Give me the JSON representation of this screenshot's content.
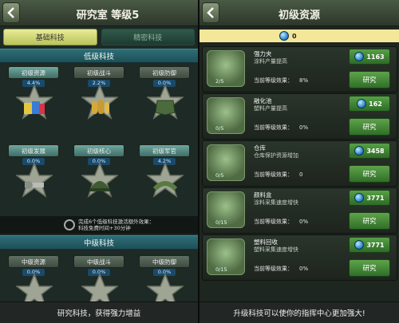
{
  "left": {
    "title": "研究室 等级5",
    "tabs": [
      "基础科技",
      "精密科技"
    ],
    "basic_section": "低级科技",
    "mid_section": "中级科技",
    "techs": [
      {
        "label": "初级资源",
        "pct": "4.4%",
        "lit": true
      },
      {
        "label": "初级战斗",
        "pct": "2.2%",
        "lit": false
      },
      {
        "label": "初级防御",
        "pct": "0.0%",
        "lit": false
      },
      {
        "label": "初级发展",
        "pct": "0.0%",
        "lit": true
      },
      {
        "label": "初级核心",
        "pct": "0.0%",
        "lit": true
      },
      {
        "label": "初级军官",
        "pct": "4.2%",
        "lit": true
      }
    ],
    "mid_techs": [
      {
        "label": "中级资源",
        "pct": "0.0%"
      },
      {
        "label": "中级战斗",
        "pct": "0.0%"
      },
      {
        "label": "中级防御",
        "pct": "0.0%"
      }
    ],
    "notice": [
      "完成6个低级科技激活额外效果：",
      "科技免费时间+30分钟"
    ],
    "footer": "研究科技，获得强力增益"
  },
  "right": {
    "title": "初级资源",
    "resource_value": "0",
    "rows": [
      {
        "name": "强力夹",
        "desc": "涂料产量提高",
        "effect_label": "当前等级效果：",
        "effect": "8%",
        "level": "2/5",
        "cost": "1163",
        "button": "研究"
      },
      {
        "name": "融化池",
        "desc": "塑料产量提高",
        "effect_label": "当前等级效果：",
        "effect": "0%",
        "level": "0/5",
        "cost": "162",
        "button": "研究"
      },
      {
        "name": "仓库",
        "desc": "仓库保护资源增加",
        "effect_label": "当前等级效果：",
        "effect": "0",
        "level": "0/5",
        "cost": "3458",
        "button": "研究"
      },
      {
        "name": "颜料盒",
        "desc": "涂料采集速度增快",
        "effect_label": "当前等级效果：",
        "effect": "0%",
        "level": "0/15",
        "cost": "3771",
        "button": "研究"
      },
      {
        "name": "塑料回收",
        "desc": "塑料采集速度增快",
        "effect_label": "当前等级效果：",
        "effect": "0%",
        "level": "0/15",
        "cost": "3771",
        "button": "研究"
      }
    ],
    "footer": "升级科技可以使你的指挥中心更加强大!"
  },
  "icons": [
    "back-icon",
    "gem-icon",
    "search-icon"
  ]
}
